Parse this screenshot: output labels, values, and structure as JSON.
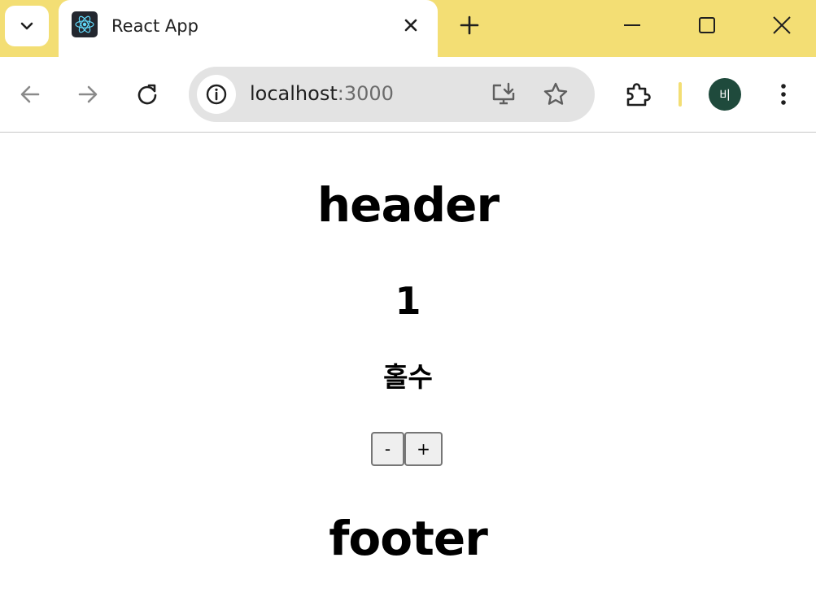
{
  "browser": {
    "tab": {
      "title": "React App",
      "favicon": "react-logo-icon",
      "close_icon": "close-icon"
    },
    "address_bar": {
      "host": "localhost",
      "port": ":3000"
    },
    "profile": {
      "initial": "비",
      "color": "#1f4a3c"
    },
    "theme_color": "#f3de74"
  },
  "page": {
    "header": "header",
    "count": "1",
    "parity": "홀수",
    "decrement_label": "-",
    "increment_label": "+",
    "footer": "footer"
  }
}
